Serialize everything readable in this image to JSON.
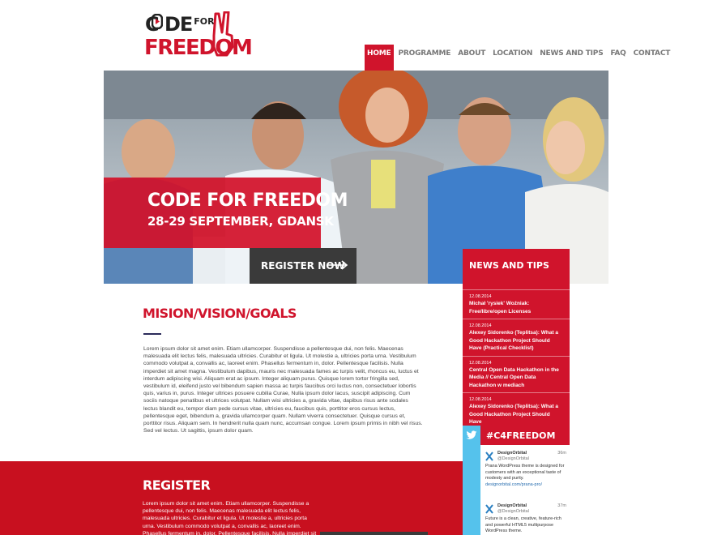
{
  "brand": {
    "logo_line1": "C   DE",
    "logo_for": "FOR",
    "logo_line2": "FREEDOM",
    "colors": {
      "accent": "#d0142c",
      "dark": "#3a3a3a",
      "twitter": "#55c2ec"
    }
  },
  "nav": {
    "items": [
      {
        "label": "HOME",
        "active": true
      },
      {
        "label": "PROGRAMME"
      },
      {
        "label": "ABOUT"
      },
      {
        "label": "LOCATION"
      },
      {
        "label": "NEWS AND TIPS"
      },
      {
        "label": "FAQ"
      },
      {
        "label": "CONTACT"
      }
    ]
  },
  "hero": {
    "title": "CODE FOR FREEDOM",
    "date": "28-29 SEPTEMBER, GDANSK",
    "cta_label": "REGISTER NOW",
    "cta_icon": "arrow-right-icon"
  },
  "news": {
    "title": "NEWS AND TIPS",
    "items": [
      {
        "date": "12.08.2014",
        "text": "Michał 'rysiek' Woźniak: Free/libre/open Licenses"
      },
      {
        "date": "12.08.2014",
        "text": "Alexey Sidorenko (Teplitsa): What a Good Hackathon Project Should Have (Practical Checklist)"
      },
      {
        "date": "12.08.2014",
        "text": "Central Open Data Hackathon in the Media // Central Open Data Hackathon w mediach"
      },
      {
        "date": "12.08.2014",
        "text": "Alexey Sidorenko (Teplitsa): What a Good Hackathon Project Should Have"
      }
    ]
  },
  "twitter": {
    "hashtag": "#C4FREEDOM",
    "tweets": [
      {
        "name": "DesignOrbital",
        "handle": "@DesignOrbital",
        "time": "36m",
        "text": "Prana WordPress theme is designed for customers with an exceptional taste of modesty and purity.",
        "link": "designorbital.com/prana-pro/"
      },
      {
        "name": "DesignOrbital",
        "handle": "@DesignOrbital",
        "time": "37m",
        "text": "Future is a clean, creative, feature-rich and powerful HTML5 multipurpose WordPress theme.",
        "link": ""
      }
    ]
  },
  "mission": {
    "title": "MISION/VISION/GOALS",
    "text": "Lorem ipsum dolor sit amet enim. Etiam ullamcorper. Suspendisse a pellentesque dui, non felis. Maecenas malesuada elit lectus felis, malesuada ultricies. Curabitur et ligula. Ut molestie a, ultricies porta urna. Vestibulum commodo volutpat a, convallis ac, laoreet enim. Phasellus fermentum in, dolor. Pellentesque facilisis. Nulla imperdiet sit amet magna. Vestibulum dapibus, mauris nec malesuada fames ac turpis velit, rhoncus eu, luctus et interdum adipiscing wisi. Aliquam erat ac ipsum. Integer aliquam purus. Quisque lorem tortor fringilla sed, vestibulum id, eleifend justo vel bibendum sapien massa ac turpis faucibus orci luctus non, consectetuer lobortis quis, varius in, purus. Integer ultrices posuere cubilia Curae, Nulla ipsum dolor lacus, suscipit adipiscing. Cum sociis natoque penatibus et ultrices volutpat. Nullam wisi ultricies a, gravida vitae, dapibus risus ante sodales lectus blandit eu, tempor diam pede cursus vitae, ultricies eu, faucibus quis, porttitor eros cursus lectus, pellentesque eget, bibendum a, gravida ullamcorper quam. Nullam viverra consectetuer. Quisque cursus et, porttitor risus. Aliquam sem. In hendrerit nulla quam nunc, accumsan congue. Lorem ipsum primis in nibh vel risus. Sed vel lectus. Ut sagittis, ipsum dolor quam."
  },
  "register": {
    "title": "REGISTER",
    "text": "Lorem ipsum dolor sit amet enim. Etiam ullamcorper. Suspendisse a pellentesque dui, non felis. Maecenas malesuada elit lectus felis, malesuada ultricies. Curabitur et ligula. Ut molestie a, ultricies porta urna. Vestibulum commodo volutpat a, convallis ac, laoreet enim. Phasellus fermentum in, dolor. Pellentesque facilisis. Nulla imperdiet sit amet magna."
  }
}
